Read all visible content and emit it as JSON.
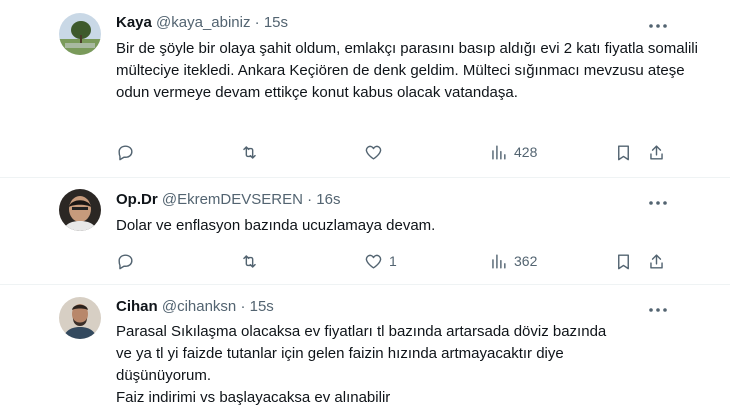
{
  "tweets": [
    {
      "name": "Kaya",
      "handle": "@kaya_abiniz",
      "dot": "·",
      "time": "15s",
      "body": "Bir de şöyle bir olaya şahit oldum, emlakçı parasını basıp aldığı evi 2 katı fiyatla  somalili mülteciye itekledi. Ankara Keçiören de denk geldim. Mülteci sığınmacı mevzusu ateşe odun vermeye devam ettikçe konut kabus olacak vatandaşa.",
      "likes": "",
      "views": "428"
    },
    {
      "name": "Op.Dr",
      "handle": "@EkremDEVSEREN",
      "dot": "·",
      "time": "16s",
      "body": "Dolar ve enflasyon bazında ucuzlamaya devam.",
      "likes": "1",
      "views": "362"
    },
    {
      "name": "Cihan",
      "handle": "@cihanksn",
      "dot": "·",
      "time": "15s",
      "body_lines": [
        "Parasal Sıkılaşma olacaksa ev fiyatları tl bazında artarsada döviz bazında",
        "ve ya tl yi faizde tutanlar için gelen faizin hızında artmayacaktır diye",
        "düşünüyorum.",
        "Faiz indirimi vs başlayacaksa ev alınabilir"
      ]
    }
  ],
  "icons": {
    "reply": "reply-icon",
    "retweet": "retweet-icon",
    "like": "heart-icon",
    "views": "views-chart-icon",
    "bookmark": "bookmark-icon",
    "share": "share-icon",
    "more": "more-dots-icon"
  },
  "colors": {
    "text": "#0f1419",
    "secondary": "#536471",
    "divider": "#eff3f4"
  }
}
